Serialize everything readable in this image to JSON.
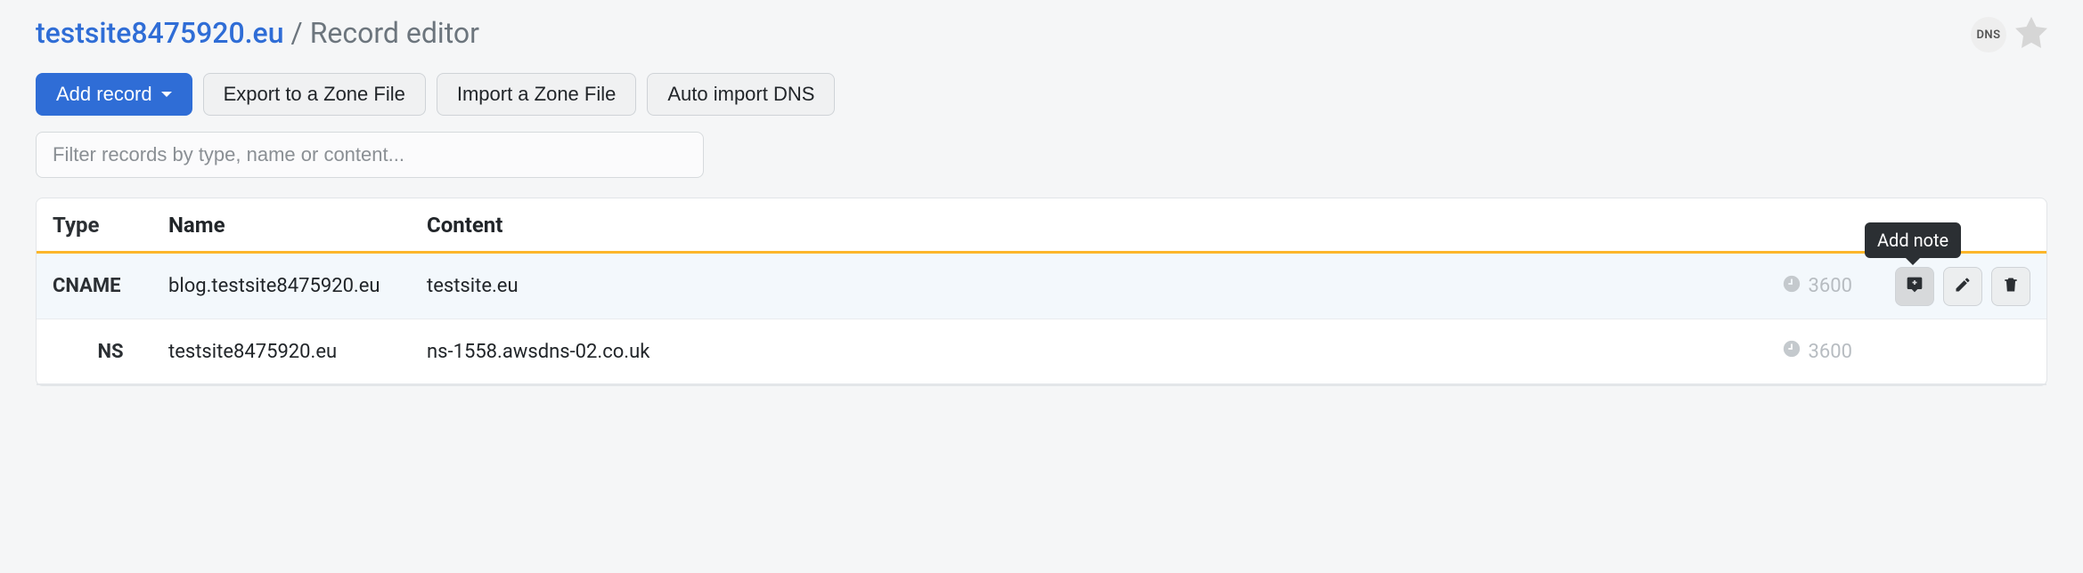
{
  "breadcrumb": {
    "domain": "testsite8475920.eu",
    "separator": "/",
    "page": "Record editor"
  },
  "header_badge": "DNS",
  "toolbar": {
    "add_record_label": "Add record",
    "export_label": "Export to a Zone File",
    "import_label": "Import a Zone File",
    "auto_import_label": "Auto import DNS"
  },
  "filter": {
    "placeholder": "Filter records by type, name or content..."
  },
  "table": {
    "columns": {
      "type": "Type",
      "name": "Name",
      "content": "Content"
    },
    "rows": [
      {
        "type": "CNAME",
        "name": "blog.testsite8475920.eu",
        "content": "testsite.eu",
        "ttl": "3600",
        "selected": true
      },
      {
        "type": "NS",
        "name": "testsite8475920.eu",
        "content": "ns-1558.awsdns-02.co.uk",
        "ttl": "3600",
        "selected": false
      }
    ]
  },
  "tooltip": {
    "add_note": "Add note"
  },
  "icons": {
    "clock": "clock-icon",
    "note": "note-icon",
    "edit": "pencil-icon",
    "delete": "trash-icon",
    "star": "star-icon",
    "caret": "caret-down-icon"
  }
}
